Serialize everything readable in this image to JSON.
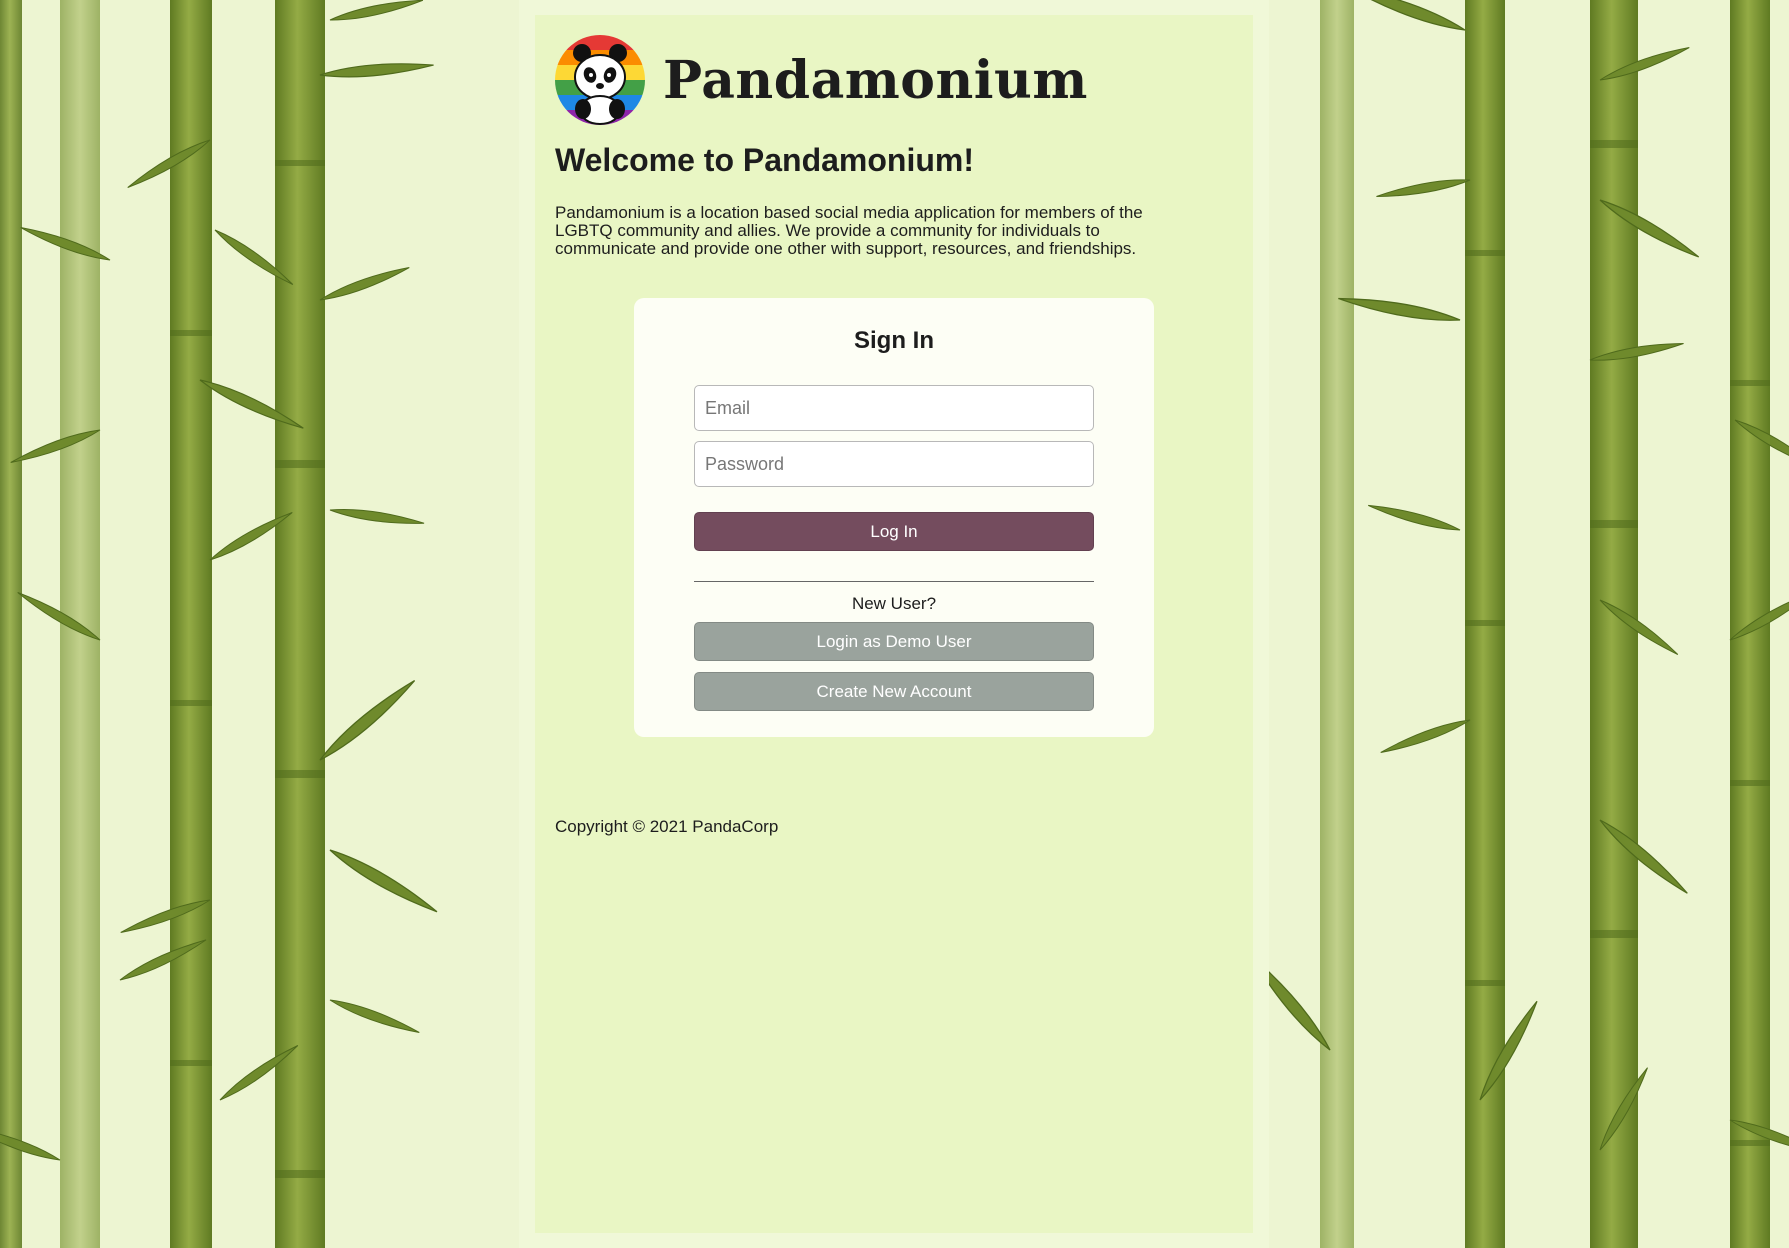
{
  "brand": {
    "name": "Pandamonium",
    "logo_icon": "rainbow-panda-logo"
  },
  "welcome": {
    "title": "Welcome to Pandamonium!",
    "description": "Pandamonium is a location based social media application for members of the LGBTQ community and allies. We provide a community for individuals to communicate and provide one other with support, resources, and friendships."
  },
  "signin": {
    "title": "Sign In",
    "email_placeholder": "Email",
    "email_value": "",
    "password_placeholder": "Password",
    "password_value": "",
    "login_label": "Log In",
    "new_user_label": "New User?",
    "demo_label": "Login as Demo User",
    "create_label": "Create New Account"
  },
  "footer": {
    "copyright": "Copyright © 2021 PandaCorp"
  },
  "colors": {
    "primary_button": "#744c5e",
    "secondary_button": "#9aa39d",
    "panel": "#e9f6c4",
    "bamboo": "#7e9433"
  }
}
